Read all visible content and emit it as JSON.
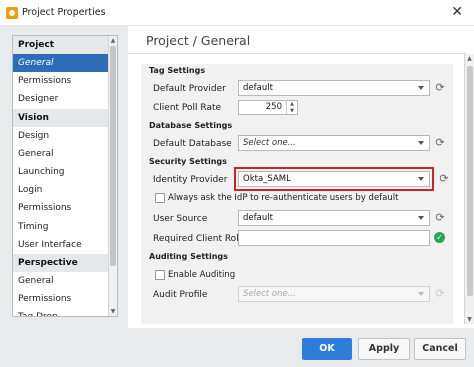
{
  "window": {
    "title": "Project Properties",
    "close_glyph": "✕"
  },
  "sidebar": {
    "groups": [
      {
        "header": "Project",
        "items": [
          {
            "label": "General",
            "selected": true
          },
          {
            "label": "Permissions"
          },
          {
            "label": "Designer"
          }
        ]
      },
      {
        "header": "Vision",
        "items": [
          {
            "label": "Design"
          },
          {
            "label": "General"
          },
          {
            "label": "Launching"
          },
          {
            "label": "Login"
          },
          {
            "label": "Permissions"
          },
          {
            "label": "Timing"
          },
          {
            "label": "User Interface"
          }
        ]
      },
      {
        "header": "Perspective",
        "items": [
          {
            "label": "General"
          },
          {
            "label": "Permissions"
          },
          {
            "label": "Tag Drop"
          }
        ]
      }
    ]
  },
  "panel": {
    "title": "Project / General",
    "tag_settings": {
      "title": "Tag Settings",
      "default_provider_label": "Default Provider",
      "default_provider_value": "default",
      "client_poll_rate_label": "Client Poll Rate",
      "client_poll_rate_value": "250"
    },
    "database_settings": {
      "title": "Database Settings",
      "default_database_label": "Default Database",
      "default_database_value": "Select one..."
    },
    "security_settings": {
      "title": "Security Settings",
      "identity_provider_label": "Identity Provider",
      "identity_provider_value": "Okta_SAML",
      "reauth_label": "Always ask the IdP to re-authenticate users by default",
      "reauth_checked": false,
      "user_source_label": "User Source",
      "user_source_value": "default",
      "required_roles_label": "Required Client Roles",
      "required_roles_value": ""
    },
    "auditing_settings": {
      "title": "Auditing Settings",
      "enable_auditing_label": "Enable Auditing",
      "enable_auditing_checked": false,
      "audit_profile_label": "Audit Profile",
      "audit_profile_value": "Select one..."
    }
  },
  "buttons": {
    "ok": "OK",
    "apply": "Apply",
    "cancel": "Cancel"
  },
  "colors": {
    "accent": "#2f7ddb",
    "selection": "#2f6db8",
    "highlight": "#d0202a",
    "valid": "#2ea44f"
  }
}
